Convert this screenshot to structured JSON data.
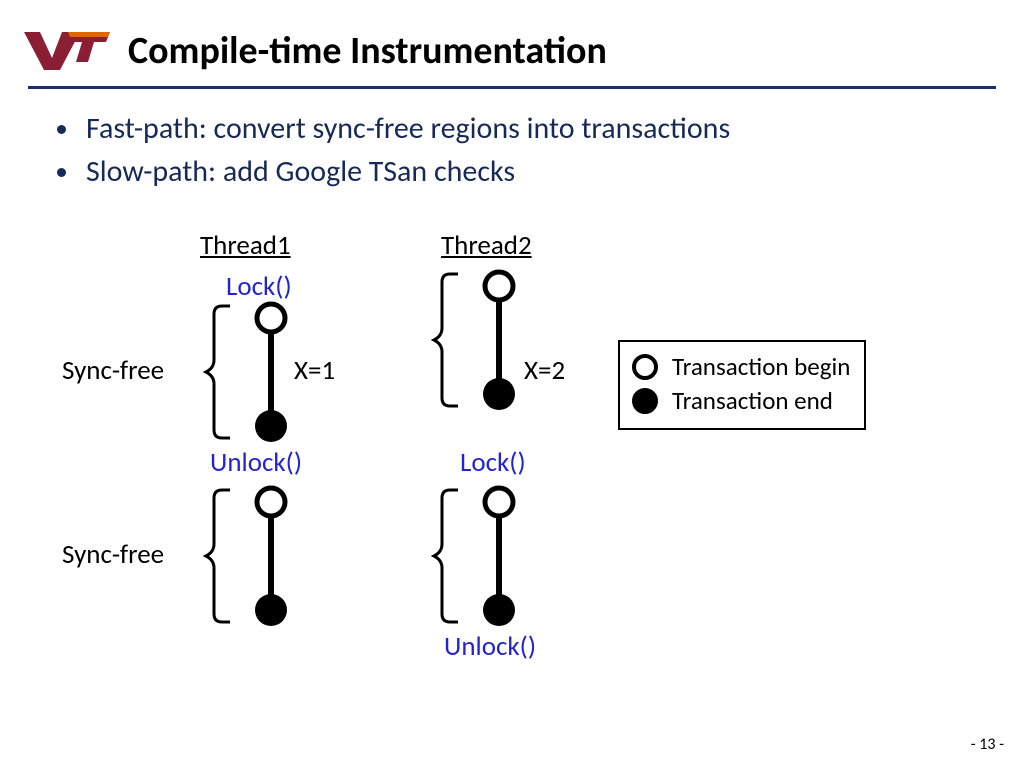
{
  "title": "Compile-time Instrumentation",
  "bullets": [
    "Fast-path: convert sync-free regions into transactions",
    "Slow-path: add Google TSan checks"
  ],
  "threads": {
    "t1": "Thread1",
    "t2": "Thread2"
  },
  "labels": {
    "syncfree": "Sync-free",
    "lock": "Lock()",
    "unlock": "Unlock()",
    "x1": "X=1",
    "x2": "X=2"
  },
  "legend": {
    "begin": "Transaction begin",
    "end": "Transaction end"
  },
  "page": "- 13 -"
}
